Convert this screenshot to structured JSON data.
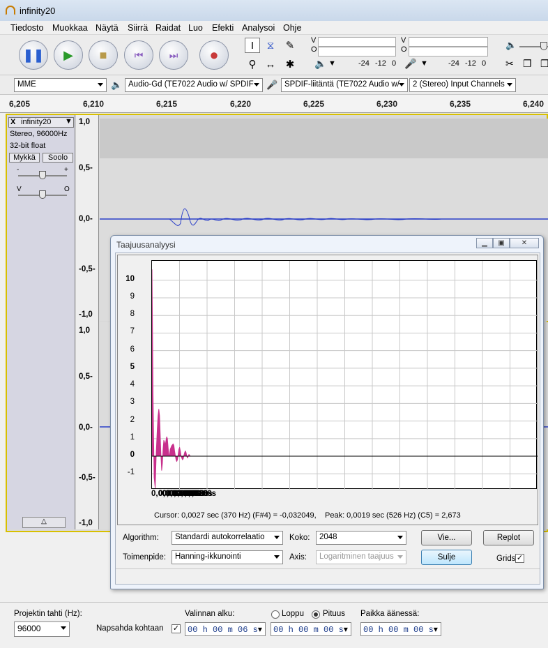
{
  "window": {
    "title": "infinity20"
  },
  "menu": [
    "Tiedosto",
    "Muokkaa",
    "Näytä",
    "Siirrä",
    "Raidat",
    "Luo",
    "Efekti",
    "Analysoi",
    "Ohje"
  ],
  "meters": {
    "out_label": "V",
    "in_label": "O",
    "ticks": [
      "-24",
      "-12",
      "0"
    ]
  },
  "devices": {
    "host": "MME",
    "playback": "Audio-Gd (TE7022 Audio w/ SPDIF",
    "recording": "SPDIF-liitäntä (TE7022 Audio w/",
    "channels": "2 (Stereo) Input Channels"
  },
  "ruler": [
    "6,205",
    "6,210",
    "6,215",
    "6,220",
    "6,225",
    "6,230",
    "6,235",
    "6,240"
  ],
  "track": {
    "name": "infinity20",
    "info1": "Stereo, 96000Hz",
    "info2": "32-bit float",
    "mute": "Mykkä",
    "solo": "Soolo",
    "gain_minus": "-",
    "gain_plus": "+",
    "pan_left": "V",
    "pan_right": "O",
    "close": "X"
  },
  "vruler1": [
    "1,0",
    "0,5-",
    "0,0-",
    "-0,5-",
    "-1,0"
  ],
  "vruler2": [
    "1,0",
    "0,5-",
    "0,0-",
    "-0,5-",
    "-1,0"
  ],
  "dialog": {
    "title": "Taajuusanalyysi",
    "cursor_text": "Cursor: 0,0027 sec (370 Hz) (F#4) = -0,032049,",
    "peak_text": "Peak: 0,0019 sec (526 Hz) (C5) = 2,673",
    "algorithm_label": "Algorithm:",
    "algorithm_value": "Standardi autokorrelaatio",
    "size_label": "Koko:",
    "size_value": "2048",
    "function_label": "Toimenpide:",
    "function_value": "Hanning-ikkunointi",
    "axis_label": "Axis:",
    "axis_value": "Logaritminen taajuus",
    "export_button": "Vie...",
    "replot_button": "Replot",
    "close_button": "Sulje",
    "grids_label": "Grids",
    "grids_check": "✓"
  },
  "chart_data": {
    "type": "area",
    "color": "#c8308c",
    "xlabel": "",
    "ylabel": "",
    "xlim": [
      0,
      0.1075
    ],
    "ylim": [
      -1.9,
      11.1
    ],
    "x_ticks": [
      "0,0000s",
      "0,0020s",
      "0,0030s",
      "0,0040s",
      "0,0050s",
      "0,0060s",
      "0,0070s",
      "0,0080s",
      "0,0090s",
      "0,0100s"
    ],
    "x_tick_values": [
      0,
      0.002,
      0.003,
      0.004,
      0.005,
      0.006,
      0.007,
      0.008,
      0.009,
      0.01
    ],
    "y_ticks": [
      "10",
      "9",
      "8",
      "7",
      "6",
      "5",
      "4",
      "3",
      "2",
      "1",
      "0",
      "-1"
    ],
    "y_tick_values": [
      10,
      9,
      8,
      7,
      6,
      5,
      4,
      3,
      2,
      1,
      0,
      -1
    ],
    "grid": true,
    "x": [
      0,
      0.0003,
      0.0006,
      0.0009,
      0.0012,
      0.0015,
      0.0017,
      0.0019,
      0.0021,
      0.0023,
      0.0025,
      0.0027,
      0.0029,
      0.0031,
      0.0033,
      0.0035,
      0.0037,
      0.0039,
      0.0041,
      0.0043,
      0.0045,
      0.0047,
      0.0049,
      0.0051,
      0.0053,
      0.0055,
      0.0057,
      0.0059,
      0.0061,
      0.0063,
      0.0065,
      0.0067,
      0.0069,
      0.0071,
      0.0073,
      0.0075,
      0.0077,
      0.0079,
      0.0081,
      0.0083,
      0.0085,
      0.0087,
      0.0089,
      0.0091,
      0.0093,
      0.0095,
      0.0097,
      0.0099,
      0.0101,
      0.0103,
      0.0105,
      0.0107
    ],
    "y": [
      10.6,
      3.5,
      -1.2,
      -1.8,
      0.3,
      1.6,
      2.3,
      2.67,
      2.3,
      1.2,
      0.0,
      -0.8,
      -0.4,
      0.4,
      0.9,
      0.8,
      0.6,
      0.9,
      1.1,
      1.0,
      0.5,
      0.0,
      0.1,
      0.4,
      0.5,
      0.6,
      0.65,
      0.7,
      0.6,
      0.3,
      0.05,
      -0.2,
      -0.3,
      -0.2,
      0.1,
      0.4,
      0.5,
      0.3,
      0.0,
      -0.1,
      -0.2,
      -0.15,
      0.05,
      0.2,
      0.3,
      0.2,
      0.0,
      -0.1,
      0.0,
      0.1,
      0.05,
      0.0
    ]
  },
  "bottom": {
    "rate_label": "Projektin tahti (Hz):",
    "rate_value": "96000",
    "snap_label": "Napsahda kohtaan",
    "snap_check": "✓",
    "sel_start_label": "Valinnan alku:",
    "end_label": "Loppu",
    "length_label": "Pituus",
    "position_label": "Paikka äänessä:",
    "sel_start_value": "00 h 00 m 06 s",
    "sel_length_value": "00 h 00 m 00 s",
    "position_value": "00 h 00 m 00 s"
  }
}
